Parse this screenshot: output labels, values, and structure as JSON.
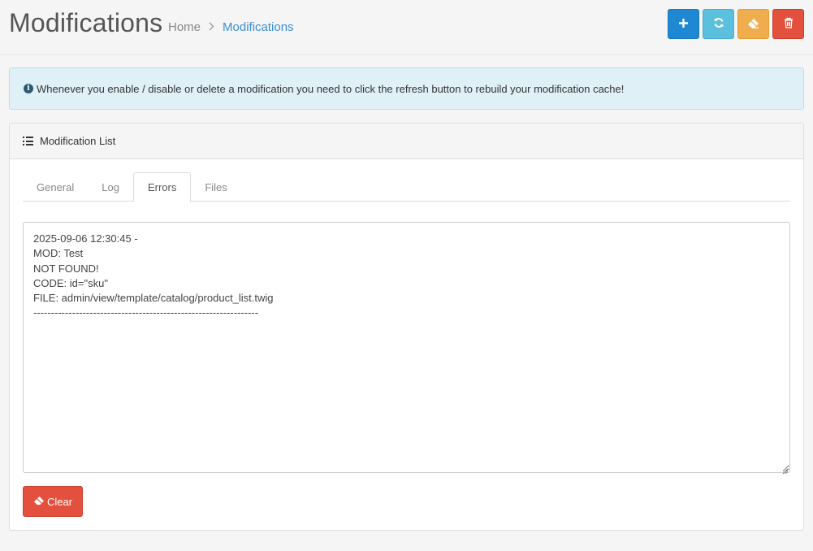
{
  "header": {
    "title": "Modifications",
    "breadcrumb": [
      {
        "label": "Home"
      },
      {
        "label": "Modifications"
      }
    ],
    "breadcrumb_separator": ">"
  },
  "toolbar": {
    "buttons": [
      {
        "name": "add",
        "icon": "plus-icon",
        "color": "#1e88d3"
      },
      {
        "name": "refresh",
        "icon": "refresh-icon",
        "color": "#5bc0de"
      },
      {
        "name": "clear",
        "icon": "eraser-icon",
        "color": "#f0ad4e"
      },
      {
        "name": "delete",
        "icon": "trash-icon",
        "color": "#e3503e"
      }
    ]
  },
  "alert": {
    "icon": "info-circle-icon",
    "text": "Whenever you enable / disable or delete a modification you need to click the refresh button to rebuild your modification cache!"
  },
  "panel": {
    "title": "Modification List",
    "icon": "list-icon",
    "tabs": [
      {
        "label": "General",
        "active": false
      },
      {
        "label": "Log",
        "active": false
      },
      {
        "label": "Errors",
        "active": true
      },
      {
        "label": "Files",
        "active": false
      }
    ],
    "error_log": "2025-09-06 12:30:45 -\nMOD: Test\nNOT FOUND!\nCODE: id=\"sku\"\nFILE: admin/view/template/catalog/product_list.twig\n----------------------------------------------------------------",
    "clear_button": {
      "label": "Clear",
      "icon": "eraser-icon",
      "color": "#e3503e"
    }
  }
}
